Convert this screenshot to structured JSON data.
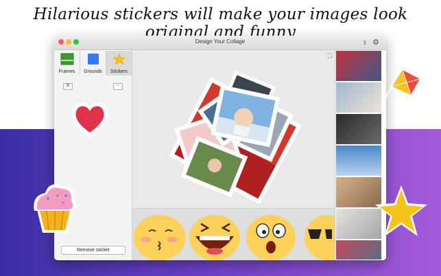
{
  "headline": "Hilarious stickers will make your images look original and funny",
  "window": {
    "title": "Design Your Collage"
  },
  "sidebar": {
    "tabs": [
      {
        "label": "Frames",
        "icon": "frames-icon"
      },
      {
        "label": "Grounds",
        "icon": "grounds-icon"
      },
      {
        "label": "Stickers",
        "icon": "star-icon"
      }
    ],
    "active_tab": "Stickers",
    "remove_button_label": "Remove sticker"
  },
  "colors": {
    "accent_blue": "#2f7cf6",
    "frames_green": "#3a9a2a",
    "star_yellow": "#f6c21c",
    "heart_red": "#e0324a",
    "bg_gradient_start": "#3b2fa3",
    "bg_gradient_end": "#a45ad9"
  },
  "stickers_tray": [
    "kiss-emoji",
    "laughing-emoji",
    "surprised-emoji",
    "sunglasses-emoji"
  ],
  "decor": [
    "cupcake-sticker",
    "kite-sticker",
    "star-sticker",
    "heart-sticker"
  ]
}
